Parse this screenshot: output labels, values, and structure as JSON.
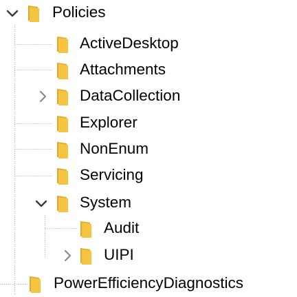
{
  "tree": {
    "root": {
      "label": "Policies",
      "state": "expanded",
      "icon": "folder-icon",
      "toggle_icon": "chevron-down-icon"
    },
    "children": [
      {
        "label": "ActiveDesktop",
        "state": "leaf",
        "icon": "folder-icon"
      },
      {
        "label": "Attachments",
        "state": "leaf",
        "icon": "folder-icon"
      },
      {
        "label": "DataCollection",
        "state": "collapsed",
        "icon": "folder-icon",
        "toggle_icon": "chevron-right-icon"
      },
      {
        "label": "Explorer",
        "state": "leaf",
        "icon": "folder-icon"
      },
      {
        "label": "NonEnum",
        "state": "leaf",
        "icon": "folder-icon"
      },
      {
        "label": "Servicing",
        "state": "leaf",
        "icon": "folder-icon"
      },
      {
        "label": "System",
        "state": "expanded",
        "icon": "folder-icon",
        "toggle_icon": "chevron-down-icon",
        "children": [
          {
            "label": "Audit",
            "state": "leaf",
            "icon": "folder-icon"
          },
          {
            "label": "UIPI",
            "state": "collapsed",
            "icon": "folder-icon",
            "toggle_icon": "chevron-right-icon"
          }
        ]
      }
    ],
    "sibling": {
      "label": "PowerEfficiencyDiagnostics",
      "state": "leaf",
      "icon": "folder-icon"
    }
  },
  "colors": {
    "folder_body": "#F5C542",
    "folder_shade": "#E0A82E",
    "chevron": "#3A3A3A",
    "chevron_collapsed": "#8A8A8A",
    "guide_line": "#A8A8A8",
    "text": "#000000",
    "background": "#FFFFFF"
  }
}
